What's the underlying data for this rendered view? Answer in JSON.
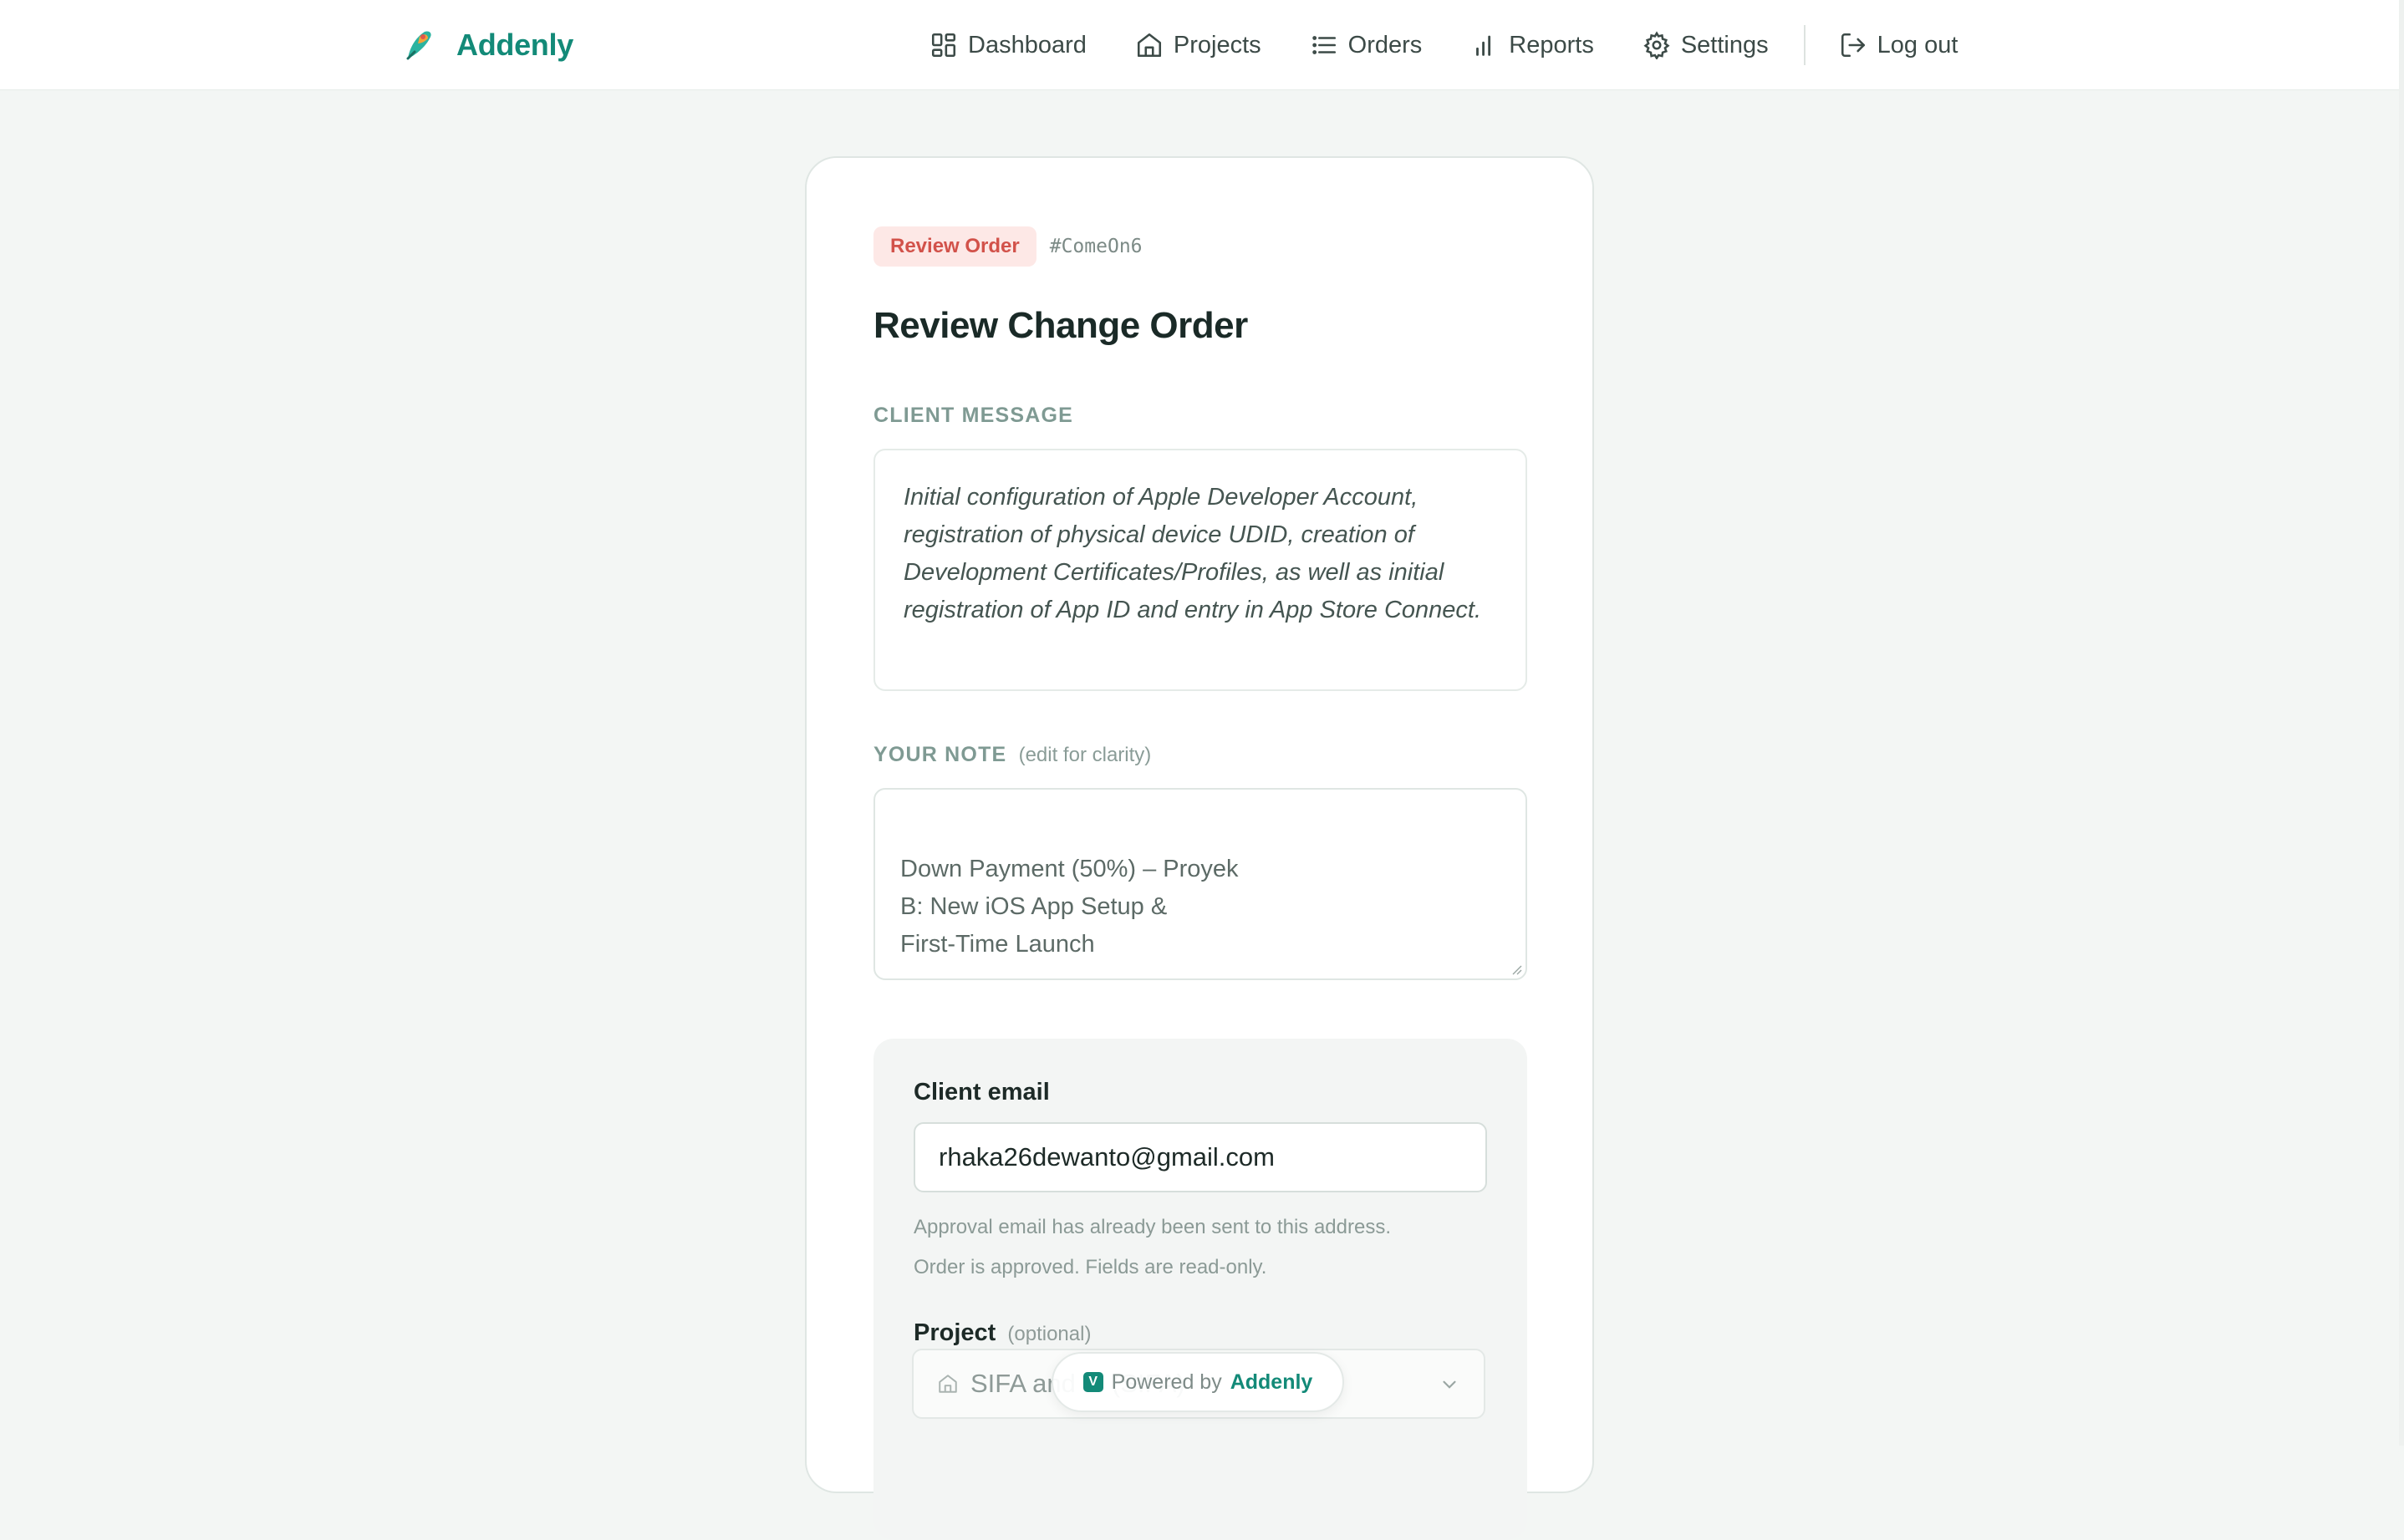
{
  "brand": {
    "name": "Addenly",
    "color": "#138a78"
  },
  "nav": {
    "items": [
      {
        "label": "Dashboard",
        "icon": "dashboard-grid-icon"
      },
      {
        "label": "Projects",
        "icon": "home-icon"
      },
      {
        "label": "Orders",
        "icon": "list-icon"
      },
      {
        "label": "Reports",
        "icon": "bar-chart-icon"
      },
      {
        "label": "Settings",
        "icon": "gear-icon"
      }
    ],
    "logout": {
      "label": "Log out",
      "icon": "logout-icon"
    }
  },
  "order": {
    "status": "Review Order",
    "status_color": "#d2524a",
    "code": "#ComeOn6",
    "title": "Review Change Order",
    "client_message_label": "CLIENT MESSAGE",
    "client_message": "Initial configuration of Apple Developer Account, registration of physical device UDID, creation of Development Certificates/Profiles, as well as initial registration of App ID and entry in App Store Connect.",
    "note_label": "YOUR NOTE",
    "note_hint": "(edit for clarity)",
    "note_value": "Down Payment (50%) – Proyek\nB: New iOS App Setup &\nFirst-Time Launch"
  },
  "client": {
    "email_label": "Client email",
    "email_value": "rhaka26dewanto@gmail.com",
    "help_sent": "Approval email has already been sent to this address.",
    "help_readonly": "Order is approved. Fields are read-only.",
    "project_label": "Project",
    "project_hint": "(optional)",
    "project_value": "SIFA and ... (SIFA)"
  },
  "footer": {
    "powered_prefix": "Powered by",
    "powered_brand": "Addenly",
    "badge": "V"
  }
}
